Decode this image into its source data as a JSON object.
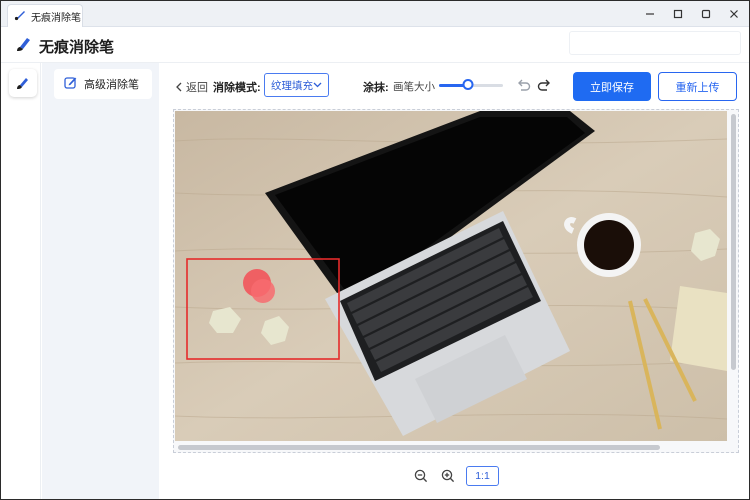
{
  "window": {
    "tab_title": "无痕消除笔",
    "controls": [
      "minimize",
      "maximize",
      "close"
    ]
  },
  "app": {
    "title": "无痕消除笔",
    "brand_color": "#2866f0"
  },
  "sidebar": {
    "items": [
      {
        "label": "高级消除笔",
        "icon": "edit-icon",
        "active": true
      }
    ]
  },
  "toolbar": {
    "back_label": "返回",
    "mode_label": "消除模式:",
    "mode_value": "纹理填充",
    "paint_label": "涂抹:",
    "brush_size_label": "画笔大小",
    "brush_size_level": 0.45,
    "save_label": "立即保存",
    "reupload_label": "重新上传"
  },
  "canvas": {
    "image_description_alt": "laptop-on-wooden-desk",
    "selection_color": "#e52b2b"
  },
  "zoom": {
    "reset_label": "1:1"
  }
}
